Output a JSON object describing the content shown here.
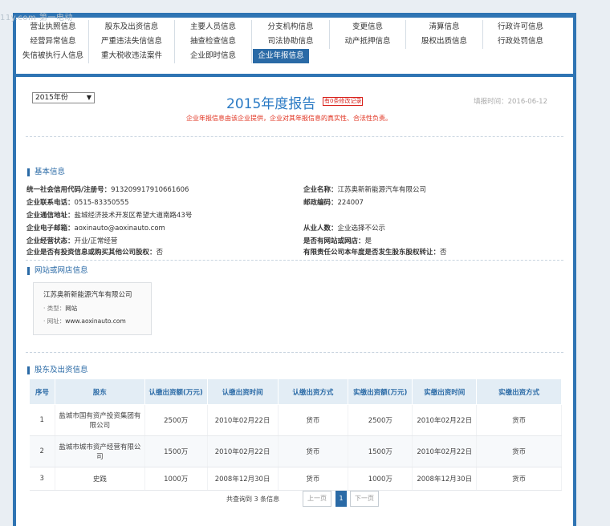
{
  "watermark": "11y.com 第一电动",
  "nav": {
    "items": [
      "营业执照信息",
      "股东及出资信息",
      "主要人员信息",
      "分支机构信息",
      "变更信息",
      "清算信息",
      "行政许可信息",
      "经营异常信息",
      "严重违法失信信息",
      "抽查检查信息",
      "司法协助信息",
      "动产抵押信息",
      "股权出质信息",
      "行政处罚信息",
      "失信被执行人信息",
      "重大税收违法案件",
      "企业即时信息",
      "企业年报信息"
    ],
    "active": "企业年报信息"
  },
  "report": {
    "year_select": "2015年份",
    "title": "2015年度报告",
    "mod_badge": "有0条修改记录",
    "fill_date": "填报时间：2016-06-12",
    "notice": "企业年报信息由该企业提供，企业对其年报信息的真实性、合法性负责。"
  },
  "basic": {
    "title": "基本信息",
    "left": [
      {
        "k": "统一社会信用代码/注册号：",
        "v": "913209917910661606"
      },
      {
        "k": "企业联系电话：",
        "v": "0515-83350555"
      },
      {
        "k": "企业通信地址：",
        "v": "盐城经济技术开发区希望大道南路43号"
      },
      {
        "k": "企业电子邮箱：",
        "v": "aoxinauto@aoxinauto.com"
      },
      {
        "k": "企业经营状态：",
        "v": "开业/正常经营"
      },
      {
        "k": "企业是否有投资信息或购买其他公司股权：",
        "v": "否"
      }
    ],
    "right": [
      {
        "k": "企业名称：",
        "v": "江苏奥新新能源汽车有限公司"
      },
      {
        "k": "邮政编码：",
        "v": "224007"
      },
      {
        "k": "从业人数：",
        "v": "企业选择不公示"
      },
      {
        "k": "是否有网站或网店：",
        "v": "是"
      },
      {
        "k": "有限责任公司本年度是否发生股东股权转让：",
        "v": "否"
      }
    ]
  },
  "website": {
    "title": "网站或网店信息",
    "card_name": "江苏奥新新能源汽车有限公司",
    "type_label": "· 类型：",
    "type_value": "网站",
    "url_label": "· 网址：",
    "url_value": "www.aoxinauto.com"
  },
  "shareholders": {
    "title": "股东及出资信息",
    "headers": [
      "序号",
      "股东",
      "认缴出资额(万元)",
      "认缴出资时间",
      "认缴出资方式",
      "实缴出资额(万元)",
      "实缴出资时间",
      "实缴出资方式"
    ],
    "rows": [
      [
        "1",
        "盐城市国有资产投资集团有限公司",
        "2500万",
        "2010年02月22日",
        "货币",
        "2500万",
        "2010年02月22日",
        "货币"
      ],
      [
        "2",
        "盐城市城市资产经营有限公司",
        "1500万",
        "2010年02月22日",
        "货币",
        "1500万",
        "2010年02月22日",
        "货币"
      ],
      [
        "3",
        "史践",
        "1000万",
        "2008年12月30日",
        "货币",
        "1000万",
        "2008年12月30日",
        "货币"
      ]
    ]
  },
  "pager": {
    "total_text": "共查询到 3 条信息",
    "prev": "上一页",
    "current": "1",
    "next": "下一页"
  }
}
